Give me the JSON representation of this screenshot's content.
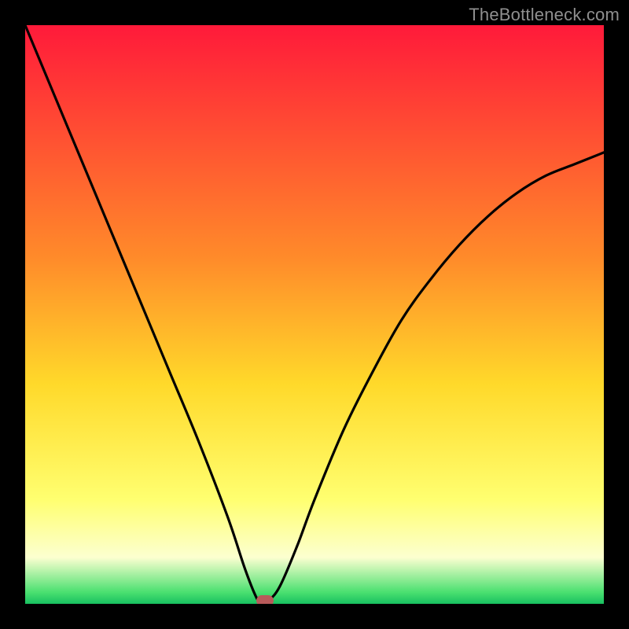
{
  "watermark": "TheBottleneck.com",
  "chart_data": {
    "type": "line",
    "title": "",
    "xlabel": "",
    "ylabel": "",
    "xlim": [
      0,
      100
    ],
    "ylim": [
      0,
      100
    ],
    "grid": false,
    "gradient_stops": [
      {
        "offset": 0,
        "color": "#ff1a3a"
      },
      {
        "offset": 40,
        "color": "#ff8a2a"
      },
      {
        "offset": 62,
        "color": "#ffd92a"
      },
      {
        "offset": 82,
        "color": "#ffff70"
      },
      {
        "offset": 92,
        "color": "#fcffd0"
      },
      {
        "offset": 98,
        "color": "#4ae070"
      },
      {
        "offset": 100,
        "color": "#18c060"
      }
    ],
    "series": [
      {
        "name": "bottleneck-curve",
        "x": [
          0,
          5,
          10,
          15,
          20,
          25,
          30,
          35,
          38,
          40,
          41,
          42,
          44,
          47,
          50,
          55,
          60,
          65,
          70,
          75,
          80,
          85,
          90,
          95,
          100
        ],
        "y": [
          100,
          88,
          76,
          64,
          52,
          40,
          28,
          15,
          6,
          1,
          0,
          0.5,
          3,
          10,
          18,
          30,
          40,
          49,
          56,
          62,
          67,
          71,
          74,
          76,
          78
        ]
      }
    ],
    "marker": {
      "x": 41.5,
      "y": 0.5,
      "color": "#b85a5a"
    }
  }
}
